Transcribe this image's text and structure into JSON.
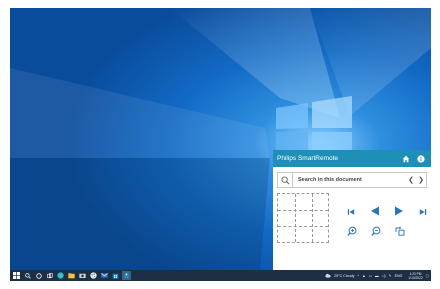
{
  "panel": {
    "title": "Philips SmartRemote",
    "search_placeholder": "Search in this document",
    "icons": [
      "home-icon",
      "info-icon",
      "search-icon",
      "chevron-left-icon",
      "chevron-right-icon",
      "skip-first-icon",
      "play-reverse-icon",
      "play-icon",
      "skip-last-icon",
      "zoom-in-icon",
      "zoom-out-icon",
      "rotate-icon"
    ]
  },
  "taskbar": {
    "apps": [
      "windows-start-icon",
      "search-icon",
      "cortana-icon",
      "task-view-icon",
      "edge-icon",
      "file-explorer-icon",
      "camera-icon",
      "paint-icon",
      "mail-icon",
      "store-icon",
      "remote-app-icon"
    ],
    "weather": "29°C  Cloudy",
    "language": "ENG",
    "time": "1:20 PM",
    "date": "1/10/2022"
  },
  "colors": {
    "panel_header": "#1e8fb6",
    "taskbar": "#1d2f45",
    "desktop": "#0f63b8"
  }
}
